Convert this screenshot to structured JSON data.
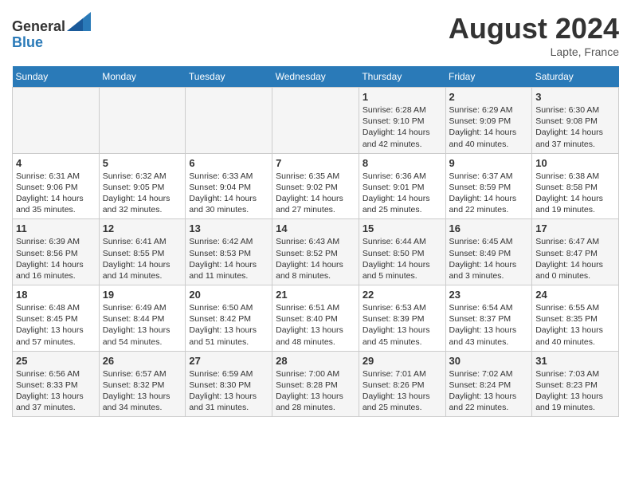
{
  "header": {
    "logo_line1": "General",
    "logo_line2": "Blue",
    "month_title": "August 2024",
    "subtitle": "Lapte, France"
  },
  "days_of_week": [
    "Sunday",
    "Monday",
    "Tuesday",
    "Wednesday",
    "Thursday",
    "Friday",
    "Saturday"
  ],
  "weeks": [
    [
      {
        "day": "",
        "info": ""
      },
      {
        "day": "",
        "info": ""
      },
      {
        "day": "",
        "info": ""
      },
      {
        "day": "",
        "info": ""
      },
      {
        "day": "1",
        "info": "Sunrise: 6:28 AM\nSunset: 9:10 PM\nDaylight: 14 hours and 42 minutes."
      },
      {
        "day": "2",
        "info": "Sunrise: 6:29 AM\nSunset: 9:09 PM\nDaylight: 14 hours and 40 minutes."
      },
      {
        "day": "3",
        "info": "Sunrise: 6:30 AM\nSunset: 9:08 PM\nDaylight: 14 hours and 37 minutes."
      }
    ],
    [
      {
        "day": "4",
        "info": "Sunrise: 6:31 AM\nSunset: 9:06 PM\nDaylight: 14 hours and 35 minutes."
      },
      {
        "day": "5",
        "info": "Sunrise: 6:32 AM\nSunset: 9:05 PM\nDaylight: 14 hours and 32 minutes."
      },
      {
        "day": "6",
        "info": "Sunrise: 6:33 AM\nSunset: 9:04 PM\nDaylight: 14 hours and 30 minutes."
      },
      {
        "day": "7",
        "info": "Sunrise: 6:35 AM\nSunset: 9:02 PM\nDaylight: 14 hours and 27 minutes."
      },
      {
        "day": "8",
        "info": "Sunrise: 6:36 AM\nSunset: 9:01 PM\nDaylight: 14 hours and 25 minutes."
      },
      {
        "day": "9",
        "info": "Sunrise: 6:37 AM\nSunset: 8:59 PM\nDaylight: 14 hours and 22 minutes."
      },
      {
        "day": "10",
        "info": "Sunrise: 6:38 AM\nSunset: 8:58 PM\nDaylight: 14 hours and 19 minutes."
      }
    ],
    [
      {
        "day": "11",
        "info": "Sunrise: 6:39 AM\nSunset: 8:56 PM\nDaylight: 14 hours and 16 minutes."
      },
      {
        "day": "12",
        "info": "Sunrise: 6:41 AM\nSunset: 8:55 PM\nDaylight: 14 hours and 14 minutes."
      },
      {
        "day": "13",
        "info": "Sunrise: 6:42 AM\nSunset: 8:53 PM\nDaylight: 14 hours and 11 minutes."
      },
      {
        "day": "14",
        "info": "Sunrise: 6:43 AM\nSunset: 8:52 PM\nDaylight: 14 hours and 8 minutes."
      },
      {
        "day": "15",
        "info": "Sunrise: 6:44 AM\nSunset: 8:50 PM\nDaylight: 14 hours and 5 minutes."
      },
      {
        "day": "16",
        "info": "Sunrise: 6:45 AM\nSunset: 8:49 PM\nDaylight: 14 hours and 3 minutes."
      },
      {
        "day": "17",
        "info": "Sunrise: 6:47 AM\nSunset: 8:47 PM\nDaylight: 14 hours and 0 minutes."
      }
    ],
    [
      {
        "day": "18",
        "info": "Sunrise: 6:48 AM\nSunset: 8:45 PM\nDaylight: 13 hours and 57 minutes."
      },
      {
        "day": "19",
        "info": "Sunrise: 6:49 AM\nSunset: 8:44 PM\nDaylight: 13 hours and 54 minutes."
      },
      {
        "day": "20",
        "info": "Sunrise: 6:50 AM\nSunset: 8:42 PM\nDaylight: 13 hours and 51 minutes."
      },
      {
        "day": "21",
        "info": "Sunrise: 6:51 AM\nSunset: 8:40 PM\nDaylight: 13 hours and 48 minutes."
      },
      {
        "day": "22",
        "info": "Sunrise: 6:53 AM\nSunset: 8:39 PM\nDaylight: 13 hours and 45 minutes."
      },
      {
        "day": "23",
        "info": "Sunrise: 6:54 AM\nSunset: 8:37 PM\nDaylight: 13 hours and 43 minutes."
      },
      {
        "day": "24",
        "info": "Sunrise: 6:55 AM\nSunset: 8:35 PM\nDaylight: 13 hours and 40 minutes."
      }
    ],
    [
      {
        "day": "25",
        "info": "Sunrise: 6:56 AM\nSunset: 8:33 PM\nDaylight: 13 hours and 37 minutes."
      },
      {
        "day": "26",
        "info": "Sunrise: 6:57 AM\nSunset: 8:32 PM\nDaylight: 13 hours and 34 minutes."
      },
      {
        "day": "27",
        "info": "Sunrise: 6:59 AM\nSunset: 8:30 PM\nDaylight: 13 hours and 31 minutes."
      },
      {
        "day": "28",
        "info": "Sunrise: 7:00 AM\nSunset: 8:28 PM\nDaylight: 13 hours and 28 minutes."
      },
      {
        "day": "29",
        "info": "Sunrise: 7:01 AM\nSunset: 8:26 PM\nDaylight: 13 hours and 25 minutes."
      },
      {
        "day": "30",
        "info": "Sunrise: 7:02 AM\nSunset: 8:24 PM\nDaylight: 13 hours and 22 minutes."
      },
      {
        "day": "31",
        "info": "Sunrise: 7:03 AM\nSunset: 8:23 PM\nDaylight: 13 hours and 19 minutes."
      }
    ]
  ]
}
